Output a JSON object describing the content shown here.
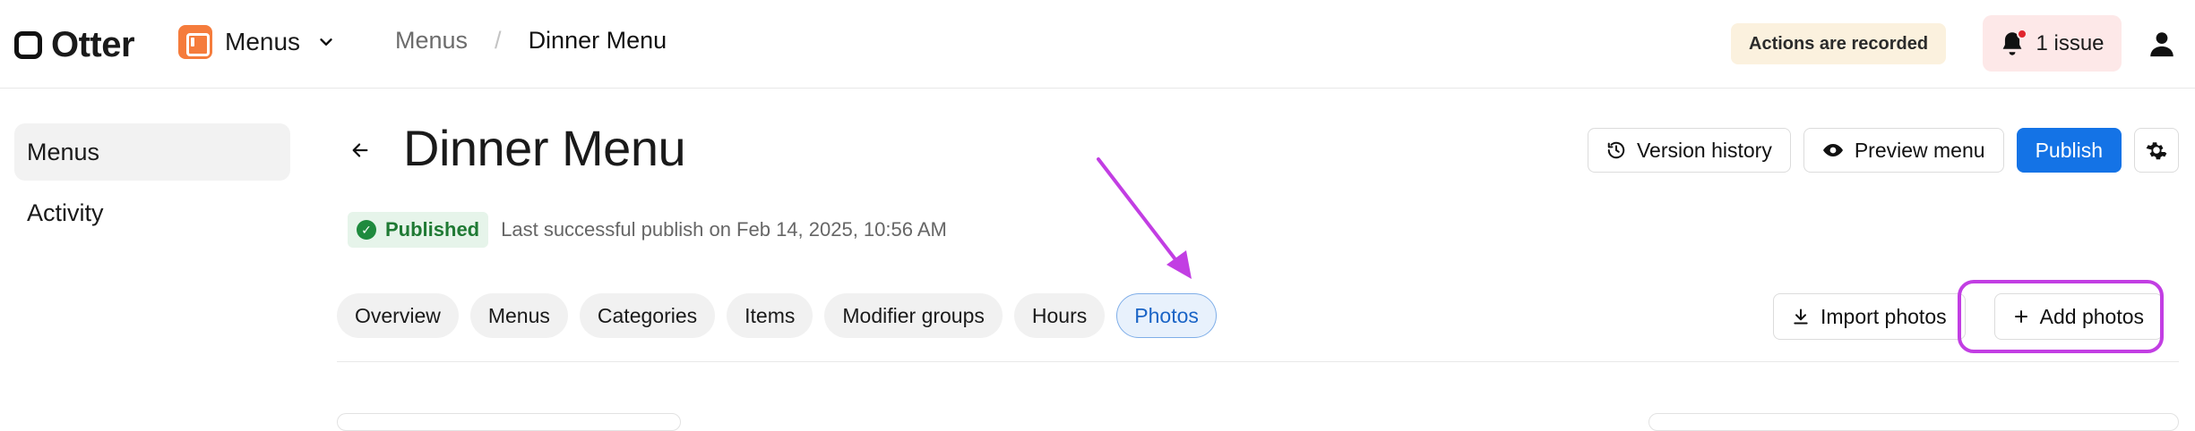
{
  "header": {
    "logo_text": "Otter",
    "app_name": "Menus",
    "breadcrumb": [
      "Menus",
      "Dinner Menu"
    ],
    "breadcrumb_sep": "/",
    "recorded_badge": "Actions are recorded",
    "issue_label": "1 issue"
  },
  "sidebar": {
    "items": [
      {
        "label": "Menus",
        "active": true
      },
      {
        "label": "Activity",
        "active": false
      }
    ]
  },
  "page": {
    "title": "Dinner Menu",
    "status_badge": "Published",
    "status_text": "Last successful publish on Feb 14, 2025, 10:56 AM",
    "actions": {
      "version_history": "Version history",
      "preview_menu": "Preview menu",
      "publish": "Publish"
    }
  },
  "tabs": [
    {
      "label": "Overview",
      "active": false
    },
    {
      "label": "Menus",
      "active": false
    },
    {
      "label": "Categories",
      "active": false
    },
    {
      "label": "Items",
      "active": false
    },
    {
      "label": "Modifier groups",
      "active": false
    },
    {
      "label": "Hours",
      "active": false
    },
    {
      "label": "Photos",
      "active": true
    }
  ],
  "photos": {
    "import_label": "Import photos",
    "add_label": "Add photos"
  },
  "colors": {
    "primary": "#1473e6",
    "app_icon": "#f57c3c",
    "annotation": "#c23ee3",
    "published_green": "#1f8a3e"
  }
}
